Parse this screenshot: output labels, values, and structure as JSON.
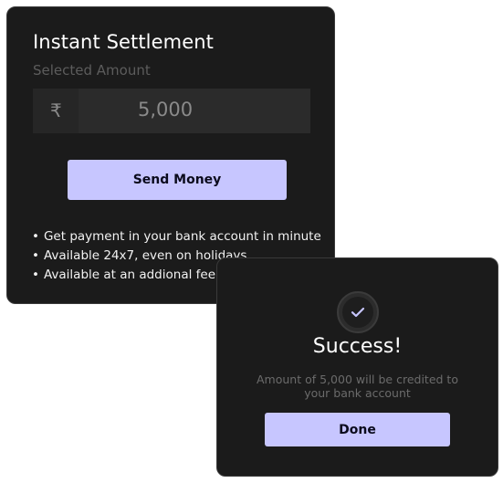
{
  "settlement": {
    "title": "Instant Settlement",
    "amount_label": "Selected Amount",
    "currency_symbol": "₹",
    "amount_value": "5,000",
    "send_button_label": "Send Money",
    "benefits": [
      "Get payment in your bank account in minute",
      "Available 24x7, even on holidays",
      "Available at an addional fee"
    ]
  },
  "success_dialog": {
    "icon": "checkmark-icon",
    "title": "Success!",
    "message": "Amount of 5,000 will be credited to your bank account",
    "done_button_label": "Done"
  },
  "colors": {
    "card_background": "#1b1b1b",
    "accent": "#c7c6ff",
    "check_color": "#c7c6ff",
    "muted_text": "#5c5c5c"
  }
}
